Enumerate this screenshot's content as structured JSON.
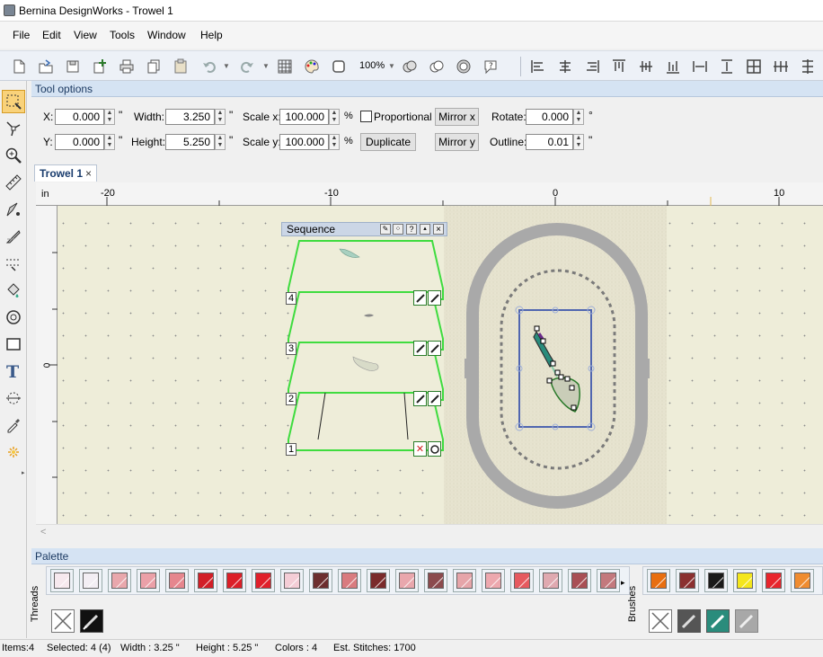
{
  "window": {
    "title": "Bernina DesignWorks - Trowel 1"
  },
  "menu": [
    "File",
    "Edit",
    "View",
    "Tools",
    "Window",
    "Help"
  ],
  "toolbar": {
    "zoom": "100%"
  },
  "tool_options": {
    "header": "Tool options",
    "x_label": "X:",
    "x_value": "0.000",
    "y_label": "Y:",
    "y_value": "0.000",
    "width_label": "Width:",
    "width_value": "3.250",
    "height_label": "Height:",
    "height_value": "5.250",
    "scalex_label": "Scale x:",
    "scalex_value": "100.000",
    "scaley_label": "Scale y:",
    "scaley_value": "100.000",
    "inch_unit": "\"",
    "percent_unit": "%",
    "proportional_label": "Proportional",
    "duplicate_label": "Duplicate",
    "mirror_x_label": "Mirror x",
    "mirror_y_label": "Mirror y",
    "rotate_label": "Rotate:",
    "rotate_value": "0.000",
    "rotate_unit": "°",
    "outline_label": "Outline:",
    "outline_value": "0.01",
    "outline_unit": "\""
  },
  "document_tab": {
    "label": "Trowel 1"
  },
  "ruler": {
    "unit": "in",
    "top_labels": [
      "-20",
      "-10",
      "0",
      "10"
    ],
    "left_label": "0"
  },
  "sequence_panel": {
    "title": "Sequence",
    "layers": [
      "4",
      "3",
      "2",
      "1"
    ]
  },
  "palette": {
    "header": "Palette",
    "threads_label": "Threads",
    "brushes_label": "Brushes",
    "thread_colors": [
      "#f7e9ee",
      "#f3eef4",
      "#e9a7ac",
      "#eba0a8",
      "#e6868e",
      "#d21e27",
      "#dc1f28",
      "#e0202b",
      "#f4cdd6",
      "#6d2e2f",
      "#d97b7f",
      "#7a2a2b",
      "#e9a7ad",
      "#8b4a4d",
      "#e6a5a9",
      "#eda8ae",
      "#e65a5f",
      "#e0a9b0",
      "#a94f55",
      "#c3797d"
    ],
    "brush_colors": [
      "#e86e10",
      "#8b3030",
      "#1a1a1a",
      "#f4e61c",
      "#e8252d",
      "#f08c30"
    ]
  },
  "status": {
    "items": "Items:4",
    "selected": "Selected: 4 (4)",
    "width": "Width : 3.25 \"",
    "height": "Height : 5.25 \"",
    "colors": "Colors : 4",
    "stitches": "Est. Stitches: 1700"
  }
}
